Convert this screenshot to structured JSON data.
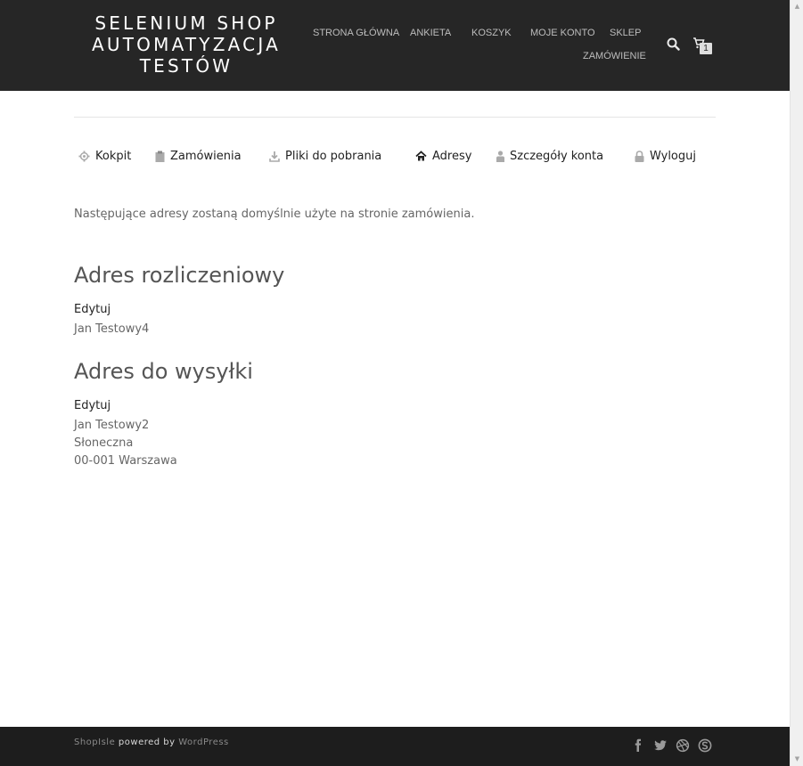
{
  "header": {
    "brand_lines": [
      "SELENIUM SHOP",
      "AUTOMATYZACJA",
      "TESTÓW"
    ],
    "nav": [
      {
        "label": "STRONA GŁÓWNA"
      },
      {
        "label": "ANKIETA"
      },
      {
        "label": "KOSZYK"
      },
      {
        "label": "MOJE KONTO"
      },
      {
        "label": "SKLEP"
      },
      {
        "label": "ZAMÓWIENIE"
      }
    ],
    "search_icon": "search-icon",
    "cart_icon": "cart-icon",
    "cart_count": "1"
  },
  "account_nav": [
    {
      "label": "Kokpit",
      "icon": "gear-icon"
    },
    {
      "label": "Zamówienia",
      "icon": "clipboard-icon"
    },
    {
      "label": "Pliki do pobrania",
      "icon": "download-icon"
    },
    {
      "label": "Adresy",
      "icon": "home-icon",
      "active": true
    },
    {
      "label": "Szczegóły konta",
      "icon": "user-icon"
    },
    {
      "label": "Wyloguj",
      "icon": "lock-icon"
    }
  ],
  "main": {
    "notice": "Następujące adresy zostaną domyślnie użyte na stronie zamówienia.",
    "billing": {
      "title": "Adres rozliczeniowy",
      "edit_label": "Edytuj",
      "lines": [
        "Jan Testowy4"
      ]
    },
    "shipping": {
      "title": "Adres do wysyłki",
      "edit_label": "Edytuj",
      "lines": [
        "Jan Testowy2",
        "Słoneczna",
        "00-001 Warszawa"
      ]
    }
  },
  "footer": {
    "credit_left": "ShopIsle",
    "credit_mid": " powered by ",
    "credit_right": "WordPress",
    "social_icons": [
      "facebook-icon",
      "twitter-icon",
      "dribbble-icon",
      "skype-icon"
    ]
  },
  "colors": {
    "header_bg": "#262626",
    "footer_bg": "#1d1d1d",
    "nav_text": "#bdbdbd"
  }
}
